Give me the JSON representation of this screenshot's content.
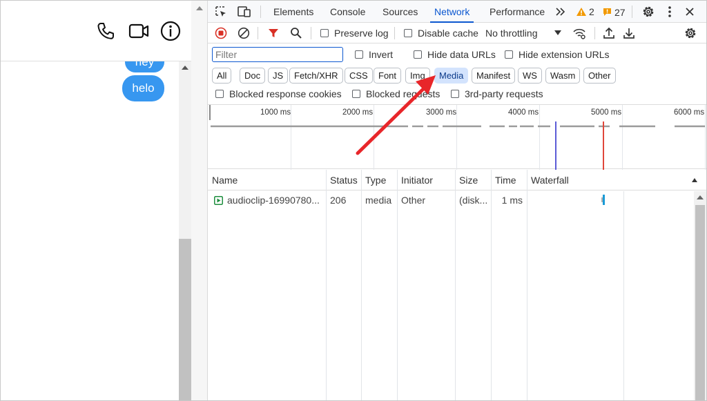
{
  "chat": {
    "bubbles": [
      "hey",
      "helo"
    ]
  },
  "devtools": {
    "tabs": [
      "Elements",
      "Console",
      "Sources",
      "Network",
      "Performance"
    ],
    "active_tab": "Network",
    "warning_count": "2",
    "issue_count": "27",
    "toolbar": {
      "preserve_log": "Preserve log",
      "disable_cache": "Disable cache",
      "throttling": "No throttling"
    },
    "filter": {
      "placeholder": "Filter",
      "invert": "Invert",
      "hide_data_urls": "Hide data URLs",
      "hide_extension_urls": "Hide extension URLs"
    },
    "type_filters": [
      "All",
      "Doc",
      "JS",
      "Fetch/XHR",
      "CSS",
      "Font",
      "Img",
      "Media",
      "Manifest",
      "WS",
      "Wasm",
      "Other"
    ],
    "selected_type_filter": "Media",
    "blocking": {
      "blocked_cookies": "Blocked response cookies",
      "blocked_requests": "Blocked requests",
      "third_party": "3rd-party requests"
    },
    "timeline_ticks": [
      "1000 ms",
      "2000 ms",
      "3000 ms",
      "4000 ms",
      "5000 ms",
      "6000 ms"
    ],
    "table": {
      "columns": [
        "Name",
        "Status",
        "Type",
        "Initiator",
        "Size",
        "Time",
        "Waterfall"
      ],
      "rows": [
        {
          "name": "audioclip-16990780...",
          "status": "206",
          "type": "media",
          "initiator": "Other",
          "size": "(disk...",
          "time": "1 ms"
        }
      ]
    }
  },
  "colors": {
    "accent": "#0b57d0",
    "bubble": "#3797f0",
    "arrow": "#e8262a",
    "record_red": "#d93025",
    "warning": "#f29900",
    "issue": "#f29900"
  },
  "icons": [
    "phone-icon",
    "video-icon",
    "info-icon",
    "inspect-icon",
    "device-toolbar-icon",
    "more-tabs-icon",
    "warning-icon",
    "issues-icon",
    "settings-icon",
    "more-vert-icon",
    "close-icon",
    "record-icon",
    "clear-icon",
    "filter-icon",
    "search-icon",
    "dropdown-icon",
    "network-conditions-icon",
    "import-icon",
    "export-icon",
    "network-settings-icon",
    "media-file-icon"
  ]
}
